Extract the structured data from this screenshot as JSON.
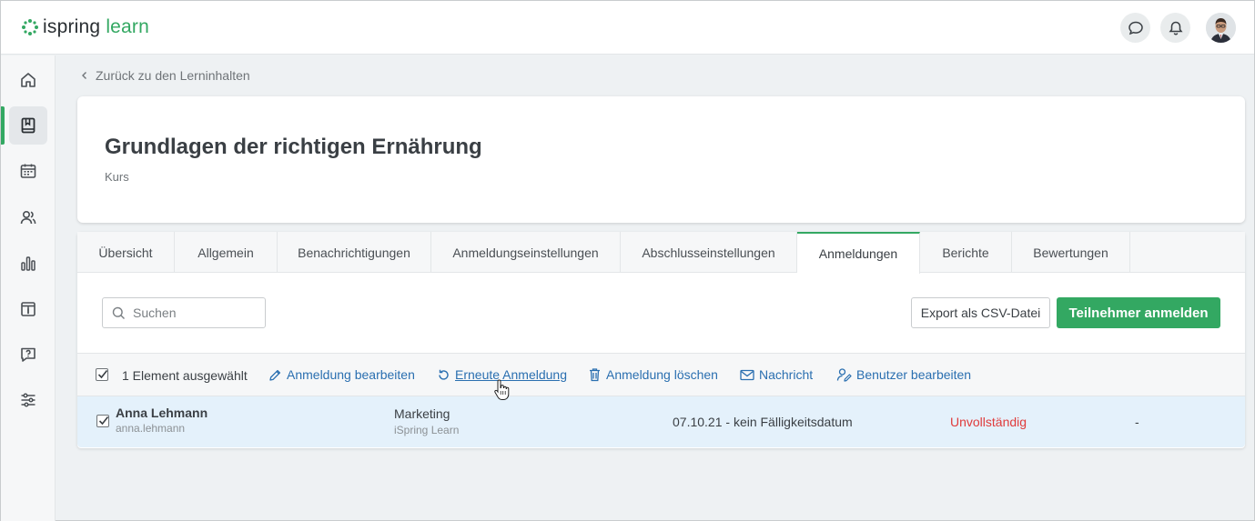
{
  "app": {
    "logo_part1": "ispring",
    "logo_part2": "learn",
    "brand_color": "#33a862",
    "link_color": "#2a6fb0",
    "status_color": "#e03b3b"
  },
  "header_icons": [
    "chat-icon",
    "bell-icon",
    "user-avatar"
  ],
  "sidebar": {
    "items": [
      "home-icon",
      "course-book-icon",
      "calendar-icon",
      "users-icon",
      "reports-chart-icon",
      "info-board-icon",
      "help-question-icon",
      "settings-sliders-icon"
    ],
    "active_index": 1
  },
  "breadcrumb": {
    "label": "Zurück zu den Lerninhalten"
  },
  "course": {
    "title": "Grundlagen der richtigen Ernährung",
    "type": "Kurs"
  },
  "tabs": [
    {
      "label": "Übersicht"
    },
    {
      "label": "Allgemein"
    },
    {
      "label": "Benachrichtigungen"
    },
    {
      "label": "Anmeldungseinstellungen"
    },
    {
      "label": "Abschlusseinstellungen"
    },
    {
      "label": "Anmeldungen"
    },
    {
      "label": "Berichte"
    },
    {
      "label": "Bewertungen"
    }
  ],
  "active_tab": "Anmeldungen",
  "toolbar": {
    "search_placeholder": "Suchen",
    "export_label": "Export als CSV-Datei",
    "enroll_label": "Teilnehmer anmelden"
  },
  "actions": {
    "selected_count": "1 Element ausgewählt",
    "edit_enrollment": "Anmeldung bearbeiten",
    "reenroll": "Erneute Anmeldung",
    "delete_enrollment": "Anmeldung löschen",
    "message": "Nachricht",
    "edit_user": "Benutzer bearbeiten"
  },
  "rows": [
    {
      "name": "Anna Lehmann",
      "login": "anna.lehmann",
      "department": "Marketing",
      "organization": "iSpring Learn",
      "dates": "07.10.21 - kein Fälligkeitsdatum",
      "status": "Unvollständig",
      "extra": "-",
      "checked": true
    }
  ]
}
